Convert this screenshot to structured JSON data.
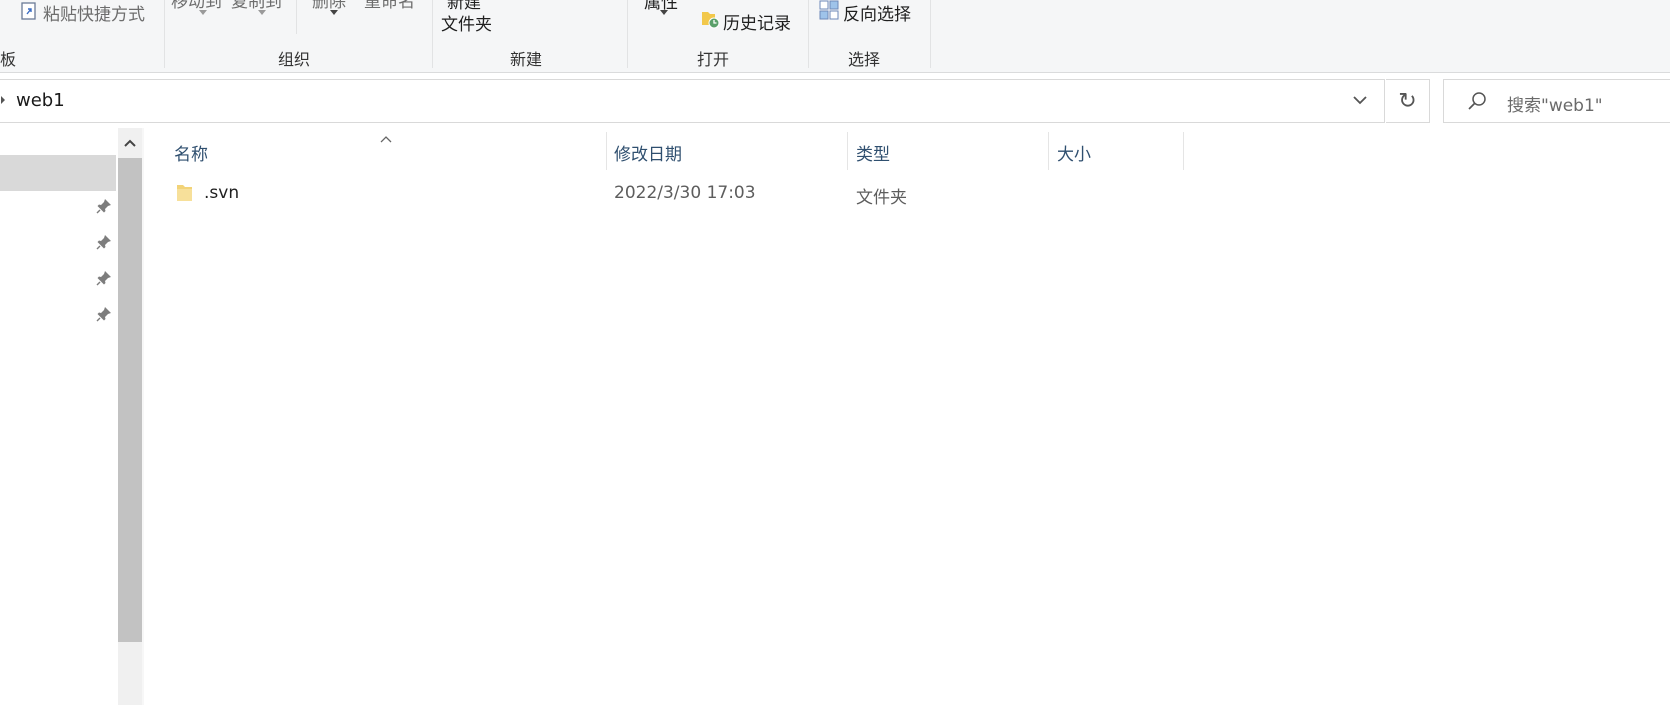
{
  "ribbon": {
    "clipboard": {
      "paste_shortcut_label": "粘贴快捷方式",
      "group_label_partial": "板"
    },
    "organize": {
      "move_to_label": "移动到",
      "copy_to_label": "复制到",
      "delete_label": "删除",
      "rename_label": "重命名",
      "group_label": "组织"
    },
    "new": {
      "new_folder_line1": "新建",
      "new_folder_line2": "文件夹",
      "group_label": "新建"
    },
    "open": {
      "properties_label": "属性",
      "history_label": "历史记录",
      "group_label": "打开"
    },
    "select": {
      "invert_selection_label": "反向选择",
      "group_label": "选择"
    }
  },
  "address_bar": {
    "path": "web1",
    "refresh_icon": "refresh-icon",
    "dropdown_icon": "chevron-down-icon"
  },
  "search": {
    "placeholder": "搜索\"web1\"",
    "icon": "search-icon"
  },
  "file_list": {
    "columns": {
      "name": "名称",
      "modified": "修改日期",
      "type": "类型",
      "size": "大小"
    },
    "sort": "name",
    "rows": [
      {
        "name": ".svn",
        "modified": "2022/3/30 17:03",
        "type": "文件夹",
        "size": "",
        "icon": "folder-icon"
      }
    ]
  },
  "nav_pane": {
    "pinned_icon_count": 4,
    "pin_icon": "pin-icon"
  },
  "colors": {
    "ribbon_bg": "#f5f6f7",
    "header_text": "#2f4f6f",
    "folder": "#f2d378",
    "selection": "#d9d9d9"
  }
}
